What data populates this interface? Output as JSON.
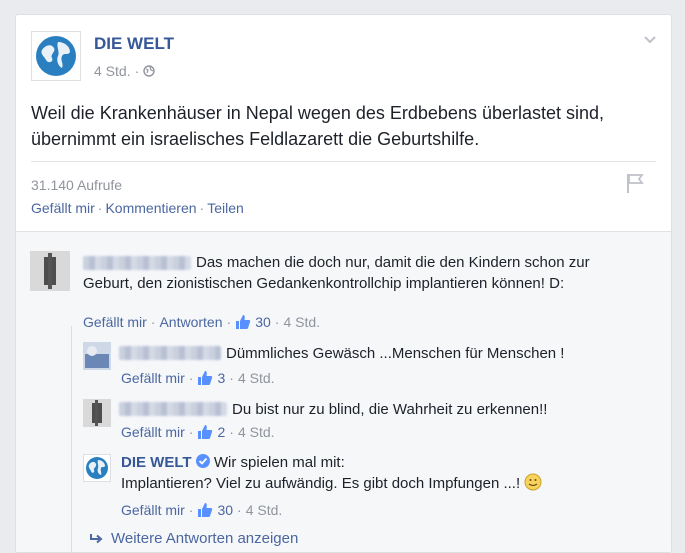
{
  "post": {
    "page_name": "DIE WELT",
    "time": "4 Std.",
    "separator": "·",
    "text": "Weil die Krankenhäuser in Nepal wegen des Erdbebens überlastet sind, übernimmt ein israelisches Feldlazarett die Geburtshilfe.",
    "views": "31.140 Aufrufe",
    "actions": {
      "like": "Gefällt mir",
      "comment": "Kommentieren",
      "share": "Teilen"
    }
  },
  "comments": [
    {
      "text": "Das machen die doch nur, damit die den Kindern schon zur Geburt, den zionistischen Gedankenkontrollchip implantieren können! D:",
      "like_label": "Gefällt mir",
      "reply_label": "Antworten",
      "likes": "30",
      "time": "4 Std."
    }
  ],
  "replies": [
    {
      "text": "Dümmliches Gewäsch ...Menschen für Menschen !",
      "like_label": "Gefällt mir",
      "likes": "3",
      "time": "4 Std."
    },
    {
      "text": "Du bist nur zu blind, die Wahrheit zu erkennen!!",
      "like_label": "Gefällt mir",
      "likes": "2",
      "time": "4 Std."
    },
    {
      "author": "DIE WELT",
      "line1": "Wir spielen mal mit:",
      "line2": "Implantieren? Viel zu aufwändig. Es gibt doch Impfungen ...!",
      "like_label": "Gefällt mir",
      "likes": "30",
      "time": "4 Std."
    }
  ],
  "more_replies": "Weitere Antworten anzeigen",
  "colors": {
    "link": "#4b67a1",
    "name": "#365899",
    "meta": "#90949c",
    "background": "#e9ebee"
  }
}
